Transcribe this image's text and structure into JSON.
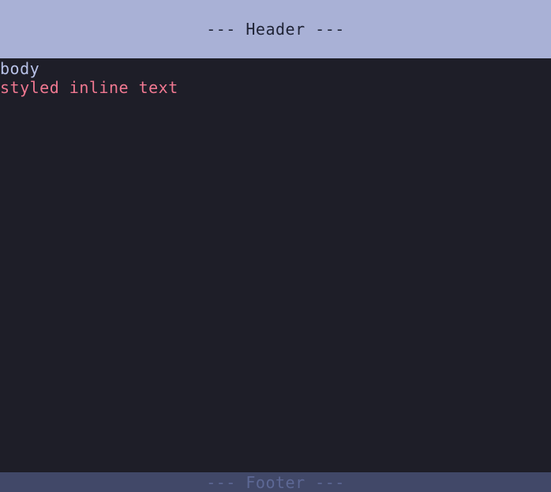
{
  "header": {
    "title": "--- Header ---"
  },
  "content": {
    "body_text": "body",
    "styled_text": "styled inline text"
  },
  "footer": {
    "title": "--- Footer ---"
  },
  "colors": {
    "background": "#1e1e28",
    "header_bg": "#a9b1d6",
    "footer_bg": "#414868",
    "body_text": "#b8c2e8",
    "styled_text": "#f07891"
  }
}
